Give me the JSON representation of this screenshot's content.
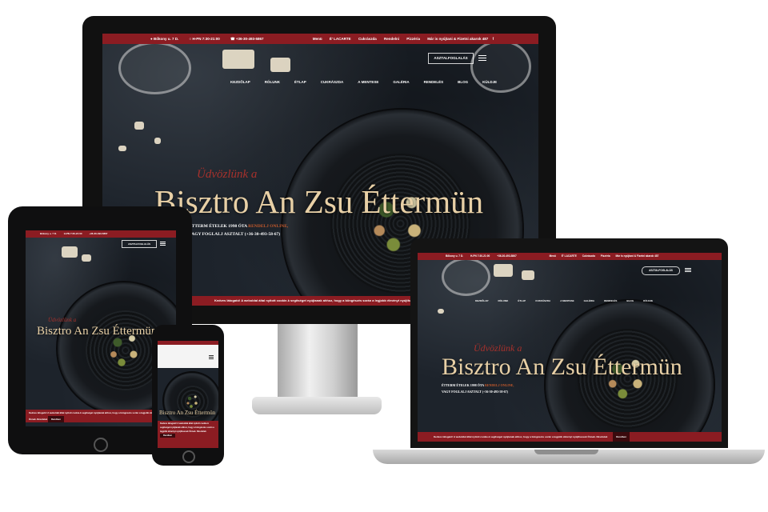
{
  "site": {
    "topbar": {
      "address": "Bőkony u. 7 D.",
      "hours": "H-PN 7:30-21:00",
      "phone": "+36-30-493-5867",
      "links": [
        "Menü",
        "É' LACARTE",
        "Cukrászda",
        "Rendelni",
        "Pizzéria",
        "Már is nyújtani & Fizetni akarok 487"
      ]
    },
    "book_button": "ASZTALFOGLALÁS",
    "nav": [
      "KEZDŐLAP",
      "RÓLUNK",
      "ÉTLAP",
      "CUKRÁSZDA",
      "A MENTESE",
      "GALÉRIA",
      "RENDELÉS",
      "BLOG",
      "KÜLDJE"
    ],
    "welcome": "Üdvözlünk a",
    "headline": "Bisztro An Zsu Éttermün",
    "sub_line1_prefix": "ÉTTERM ÉTELEK 1998 ÓTA ",
    "sub_line1_link": "RENDELJ ONLINE,",
    "sub_line2": "VAGY FOGLALJ ASZTALT (+36-30-493-58-67)",
    "cookie_text": "Kedves látogató! A weboldal által nyitott cookie-k segítséget nyújtanak ahhoz, hogy a böngészés során a legjobb élményt nyújthassuk Önnek. Részletek",
    "cookie_button": "Rendben"
  },
  "colors": {
    "brand_red": "#8b1c22",
    "headline_gold": "#e8d0a6",
    "welcome_red": "#a8312c"
  }
}
